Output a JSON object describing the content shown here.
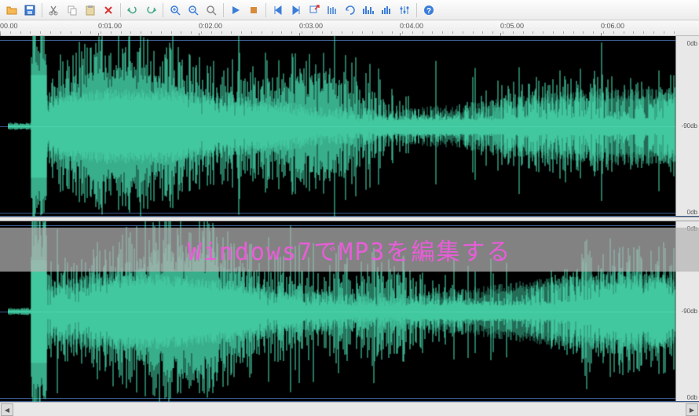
{
  "toolbar": {
    "icons": [
      "open",
      "save",
      "cut",
      "copy",
      "paste",
      "delete",
      "undo",
      "redo",
      "zoom-in",
      "zoom-out",
      "zoom-selection",
      "play",
      "stop",
      "skip-start",
      "skip-end",
      "export",
      "markers",
      "loop",
      "spectrum",
      "bars",
      "eq",
      "help"
    ]
  },
  "timeline": {
    "major_ticks": [
      {
        "pos": 0,
        "label": "00.00"
      },
      {
        "pos": 125,
        "label": "0:01.00"
      },
      {
        "pos": 253,
        "label": "0:02.00"
      },
      {
        "pos": 381,
        "label": "0:03.00"
      },
      {
        "pos": 509,
        "label": "0:04.00"
      },
      {
        "pos": 637,
        "label": "0:05.00"
      },
      {
        "pos": 765,
        "label": "0:06.00"
      }
    ]
  },
  "channels": {
    "left": {
      "db_labels": [
        {
          "pos": 5,
          "text": "0db"
        },
        {
          "pos": 110,
          "text": "-90db"
        },
        {
          "pos": 220,
          "text": "0db"
        }
      ]
    },
    "right": {
      "db_labels": [
        {
          "pos": 5,
          "text": "0db"
        },
        {
          "pos": 110,
          "text": "-90db"
        },
        {
          "pos": 220,
          "text": "0db"
        }
      ]
    }
  },
  "overlay": {
    "text": "Windows7でMP3を編集する"
  },
  "chart_data": {
    "type": "waveform",
    "title": "Stereo audio waveform",
    "channels": 2,
    "duration_sec": 6.8,
    "db_range": [
      -90,
      0
    ],
    "envelope_preview_count": 200,
    "description": "Stereo MP3 audio displayed as mirrored amplitude envelope over ~6.8 seconds with strong initial transient around 0.3s and sustained dense signal throughout."
  }
}
